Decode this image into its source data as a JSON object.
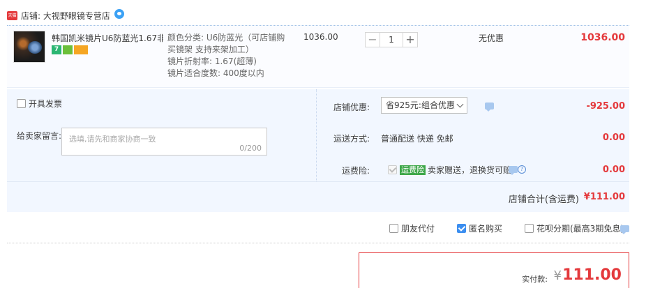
{
  "shop": {
    "badge_text": "天猫",
    "label": "店铺: 大视野眼镜专营店"
  },
  "item": {
    "title": "韩国凯米镜片U6防蓝光1.67非…",
    "service_seven": "7",
    "sku_lines": [
      "颜色分类: U6防蓝光（可店铺购",
      "买镜架 支持来架加工）",
      "镜片折射率: 1.67(超薄)",
      "镜片适合度数: 400度以内"
    ],
    "unit_price": "1036.00",
    "quantity": "1",
    "minus_glyph": "−",
    "plus_glyph": "+",
    "discount": "无优惠",
    "subtotal": "1036.00"
  },
  "invoice": {
    "label": "开具发票"
  },
  "message": {
    "label": "给卖家留言:",
    "placeholder": "选填,请先和商家协商一致",
    "counter": "0/200"
  },
  "coupon": {
    "label": "店铺优惠:",
    "selected": "省925元:组合优惠",
    "amount": "-925.00"
  },
  "shipping": {
    "label": "运送方式:",
    "value": "普通配送 快递 免邮",
    "amount": "0.00"
  },
  "insurance": {
    "label": "运费险:",
    "tag": "运费险",
    "text": "卖家赠送，退换货可赔",
    "q_glyph": "?",
    "amount": "0.00"
  },
  "shop_total": {
    "label": "店铺合计(含运费)",
    "amount": "¥111.00"
  },
  "pay_options": {
    "friend_pay": "朋友代付",
    "anonymous": "匿名购买",
    "huabei": "花呗分期(最高3期免息)"
  },
  "actual_pay": {
    "label": "实付款:",
    "yen": "¥",
    "amount": "111.00"
  },
  "colors": {
    "accent_red": "#e4393c",
    "panel_blue": "#f2f7ff",
    "check_blue": "#3b8ef0"
  }
}
